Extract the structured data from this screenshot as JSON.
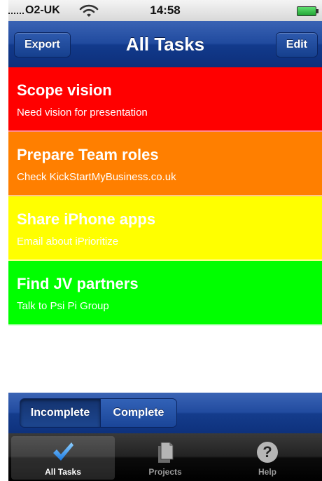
{
  "status_bar": {
    "carrier": "O2-UK",
    "time": "14:58"
  },
  "nav": {
    "title": "All Tasks",
    "left_button": "Export",
    "right_button": "Edit"
  },
  "tasks": [
    {
      "title": "Scope vision",
      "subtitle": "Need vision for presentation",
      "color": "#ff0000"
    },
    {
      "title": "Prepare Team roles",
      "subtitle": "Check KickStartMyBusiness.co.uk",
      "color": "#ff7f00"
    },
    {
      "title": "Share iPhone apps",
      "subtitle": "Email about iPrioritize",
      "color": "#ffff00"
    },
    {
      "title": "Find JV partners",
      "subtitle": "Talk to Psi Pi Group",
      "color": "#00ff00"
    }
  ],
  "segments": {
    "incomplete": "Incomplete",
    "complete": "Complete",
    "selected": "Incomplete"
  },
  "tabs": [
    {
      "label": "All Tasks",
      "icon": "checkmark-icon",
      "active": true
    },
    {
      "label": "Projects",
      "icon": "documents-icon",
      "active": false
    },
    {
      "label": "Help",
      "icon": "help-icon",
      "active": false
    }
  ]
}
